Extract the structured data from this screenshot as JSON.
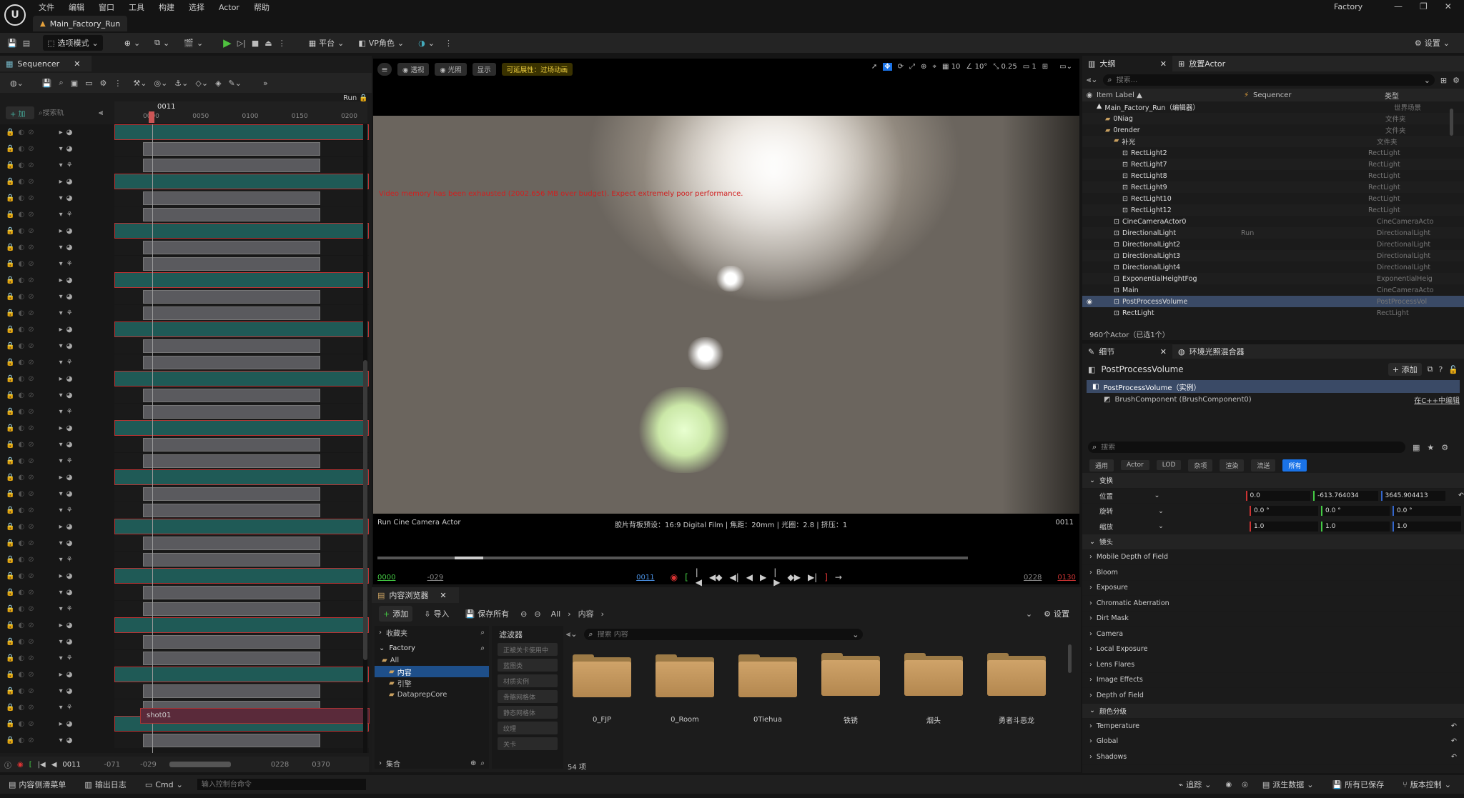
{
  "menu": [
    "文件",
    "编辑",
    "窗口",
    "工具",
    "构建",
    "选择",
    "Actor",
    "帮助"
  ],
  "project": "Factory",
  "level_tab": "Main_Factory_Run",
  "toolbar": {
    "mode": "选项模式",
    "platform": "平台",
    "vp": "VP角色",
    "settings": "设置"
  },
  "sequencer": {
    "tab": "Sequencer",
    "add": "+ 加",
    "search_placeholder": "搜索轨",
    "run": "Run",
    "frame": "0011",
    "ticks": [
      "0000",
      "0050",
      "0100",
      "0150",
      "0200"
    ],
    "bottom": {
      "current": "0011",
      "start": "-071",
      "inner_start": "-029",
      "end": "0228",
      "out": "0370"
    },
    "shot_label": "shot01"
  },
  "viewport": {
    "buttons": [
      "透视",
      "光照",
      "显示"
    ],
    "badge": "可延展性：过场动画",
    "snap": [
      "10",
      "10°",
      "0.25",
      "1"
    ],
    "warning": "Video memory has been exhausted (2002.656 MB over budget). Expect extremely poor performance.",
    "camera": "Run Cine Camera Actor",
    "filmback": "胶片背板预设：16:9 Digital Film | 焦距：20mm | 光圈：2.8 | 挤压：1",
    "frame": "0011",
    "transport": {
      "start": "0000",
      "in": "-029",
      "cur": "0011",
      "out": "0228",
      "end": "0130"
    }
  },
  "content_browser": {
    "tab": "内容浏览器",
    "add": "添加",
    "import": "导入",
    "save_all": "保存所有",
    "path": [
      "All",
      "内容"
    ],
    "settings": "设置",
    "favorites": "收藏夹",
    "project": "Factory",
    "tree": [
      "All",
      "内容",
      "引擎",
      "DataprepCore"
    ],
    "filters_title": "滤波器",
    "filters": [
      "正被关卡使用中",
      "蓝图类",
      "材质实例",
      "骨骼网格体",
      "静态网格体",
      "纹理",
      "关卡"
    ],
    "search_placeholder": "搜索 内容",
    "folders": [
      "0_FJP",
      "0_Room",
      "0Tiehua",
      "铁锈",
      "烟头",
      "勇者斗恶龙"
    ],
    "count": "54 项",
    "collections": "集合"
  },
  "outliner": {
    "tabs": [
      "大纲",
      "放置Actor"
    ],
    "search_placeholder": "搜索...",
    "cols": [
      "Item Label ▲",
      "Sequencer",
      "类型"
    ],
    "rows": [
      {
        "label": "Main_Factory_Run（编辑器）",
        "seq": "",
        "type": "世界场景",
        "ind": 0,
        "sel": false
      },
      {
        "label": "0Niag",
        "seq": "",
        "type": "文件夹",
        "ind": 1,
        "sel": false
      },
      {
        "label": "0render",
        "seq": "",
        "type": "文件夹",
        "ind": 1,
        "sel": false
      },
      {
        "label": "补光",
        "seq": "",
        "type": "文件夹",
        "ind": 2,
        "sel": false
      },
      {
        "label": "RectLight2",
        "seq": "",
        "type": "RectLight",
        "ind": 3,
        "sel": false
      },
      {
        "label": "RectLight7",
        "seq": "",
        "type": "RectLight",
        "ind": 3,
        "sel": false
      },
      {
        "label": "RectLight8",
        "seq": "",
        "type": "RectLight",
        "ind": 3,
        "sel": false
      },
      {
        "label": "RectLight9",
        "seq": "",
        "type": "RectLight",
        "ind": 3,
        "sel": false
      },
      {
        "label": "RectLight10",
        "seq": "",
        "type": "RectLight",
        "ind": 3,
        "sel": false
      },
      {
        "label": "RectLight12",
        "seq": "",
        "type": "RectLight",
        "ind": 3,
        "sel": false
      },
      {
        "label": "CineCameraActor0",
        "seq": "",
        "type": "CineCameraActo",
        "ind": 2,
        "sel": false
      },
      {
        "label": "DirectionalLight",
        "seq": "Run",
        "type": "DirectionalLight",
        "ind": 2,
        "sel": false
      },
      {
        "label": "DirectionalLight2",
        "seq": "",
        "type": "DirectionalLight",
        "ind": 2,
        "sel": false
      },
      {
        "label": "DirectionalLight3",
        "seq": "",
        "type": "DirectionalLight",
        "ind": 2,
        "sel": false
      },
      {
        "label": "DirectionalLight4",
        "seq": "",
        "type": "DirectionalLight",
        "ind": 2,
        "sel": false
      },
      {
        "label": "ExponentialHeightFog",
        "seq": "",
        "type": "ExponentialHeig",
        "ind": 2,
        "sel": false
      },
      {
        "label": "Main",
        "seq": "",
        "type": "CineCameraActo",
        "ind": 2,
        "sel": false
      },
      {
        "label": "PostProcessVolume",
        "seq": "",
        "type": "PostProcessVol",
        "ind": 2,
        "sel": true
      },
      {
        "label": "RectLight",
        "seq": "",
        "type": "RectLight",
        "ind": 2,
        "sel": false
      }
    ],
    "status": "960个Actor（已选1个）"
  },
  "details": {
    "tabs": [
      "细节",
      "环境光照混合器"
    ],
    "actor": "PostProcessVolume",
    "add": "+ 添加",
    "instance": "PostProcessVolume（实例）",
    "component": "BrushComponent (BrushComponent0)",
    "cpp": "在C++中编辑",
    "search_placeholder": "搜索",
    "filters": [
      "通用",
      "Actor",
      "LOD",
      "杂项",
      "渲染",
      "流送",
      "所有"
    ],
    "transform_header": "变换",
    "loc": {
      "label": "位置",
      "x": "0.0",
      "y": "-613.764034",
      "z": "3645.904413"
    },
    "rot": {
      "label": "旋转",
      "x": "0.0 °",
      "y": "0.0 °",
      "z": "0.0 °"
    },
    "scale": {
      "label": "缩放",
      "x": "1.0",
      "y": "1.0",
      "z": "1.0"
    },
    "lens_header": "镜头",
    "lens": [
      "Mobile Depth of Field",
      "Bloom",
      "Exposure",
      "Chromatic Aberration",
      "Dirt Mask",
      "Camera",
      "Local Exposure",
      "Lens Flares",
      "Image Effects",
      "Depth of Field"
    ],
    "grading_header": "颜色分级",
    "grading": [
      "Temperature",
      "Global",
      "Shadows"
    ]
  },
  "statusbar": {
    "drawer": "内容侧滑菜单",
    "log": "输出日志",
    "cmd": "Cmd",
    "cmd_placeholder": "输入控制台命令",
    "trace": "追踪",
    "derived": "派生数据",
    "saved": "所有已保存",
    "vc": "版本控制"
  }
}
